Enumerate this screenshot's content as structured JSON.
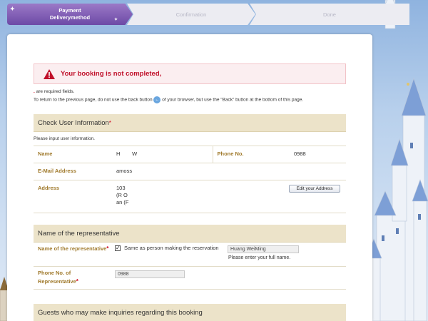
{
  "progress": {
    "steps": [
      {
        "label": "Payment\nDeliverymethod"
      },
      {
        "label": "Confirmation"
      },
      {
        "label": "Done"
      }
    ]
  },
  "error": {
    "message": "Your booking is not completed,"
  },
  "notes": {
    "required": "are required fields.",
    "back_before": "To return to the previous page, do not use the back button",
    "back_after": "of your browser, but use the \"Back\" button at the bottom of this page."
  },
  "check_user": {
    "title": "Check User Information",
    "subtitle": "Please input user information.",
    "name_label": "Name",
    "name_value": "H        W",
    "phone_label": "Phone No.",
    "phone_value": "0988",
    "email_label": "E-Mail Address",
    "email_value": "amoss",
    "address_label": "Address",
    "address_lines": [
      "103",
      "(R O",
      "an (F"
    ],
    "edit_address_label": "Edit your Address"
  },
  "representative": {
    "title": "Name of the representative",
    "name_label": "Name of the representative",
    "same_as_label": "Same as person making the reservation",
    "same_as_checked": true,
    "name_value": "Huang WeiMing",
    "name_hint": "Please enter your full name.",
    "phone_label": "Phone No. of Representative",
    "phone_value": "0988"
  },
  "inquiries": {
    "title": "Guests who may make inquiries regarding this booking"
  },
  "colors": {
    "accent_purple": "#6d4aa6",
    "section_bg": "#ece3c9",
    "label_gold": "#a07a2c",
    "error_red": "#c0102a"
  }
}
